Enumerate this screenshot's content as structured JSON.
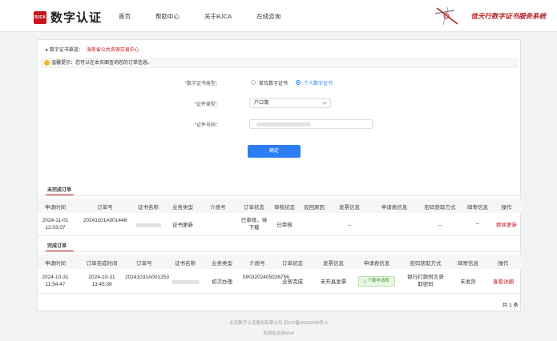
{
  "header": {
    "logo_badge": "BJCA",
    "logo_text": "数字认证",
    "nav": [
      "首页",
      "帮助中心",
      "关于BJCA",
      "在线咨询"
    ],
    "slogan": "信天行数字证书服务系统"
  },
  "channel": {
    "label": "数字证书渠道：",
    "value": "海南省公共资源交易中心"
  },
  "tip": "温馨提示：您可以在本页面查询您的订单信息。",
  "form": {
    "cert_type_label": "数字证书类型：",
    "cert_type_options": [
      "单位数字证书",
      "个人数字证书"
    ],
    "id_type_label": "证件类型：",
    "id_type_value": "户口簿",
    "id_number_label": "证件号码：",
    "confirm_label": "确定"
  },
  "unfinished": {
    "title": "未完成订单",
    "headers": [
      "申请时间",
      "订单号",
      "证书名称",
      "业务类型",
      "介质号",
      "订单状态",
      "审核状态",
      "驳回原因",
      "发票信息",
      "申请表信息",
      "密码获取方式",
      "邮寄信息",
      "操作"
    ],
    "row": {
      "time": "2024-11-01 12:03:07",
      "order": "20241101A001448",
      "business": "证书更新",
      "status": "已审核，待下载",
      "audit": "已审核",
      "invoice": "--",
      "password": "--",
      "mail": "--",
      "action": "继续更新"
    }
  },
  "finished": {
    "title": "完成订单",
    "headers": [
      "申请时间",
      "订单完成时间",
      "订单号",
      "证书名称",
      "业务类型",
      "介质号",
      "订单状态",
      "发票信息",
      "申请表信息",
      "密码获取方式",
      "邮寄信息",
      "操作"
    ],
    "row": {
      "time": "2024-10-31 11:54:47",
      "done_time": "2024-10-31 13:45:39",
      "order": "20241031A001253",
      "business": "初次办理",
      "medium": "5903202405026756",
      "status": "业务完成",
      "invoice": "未开具发票",
      "apply_btn": "下载申请表",
      "password": "银行打款附言获取密码",
      "mail": "未发货",
      "action": "查看详细"
    },
    "total": "共 1 条"
  },
  "footer": {
    "line1": "北京数字认证股份有限公司 京ICP备05031699号-6",
    "line2": "本网站支持IPv6"
  }
}
